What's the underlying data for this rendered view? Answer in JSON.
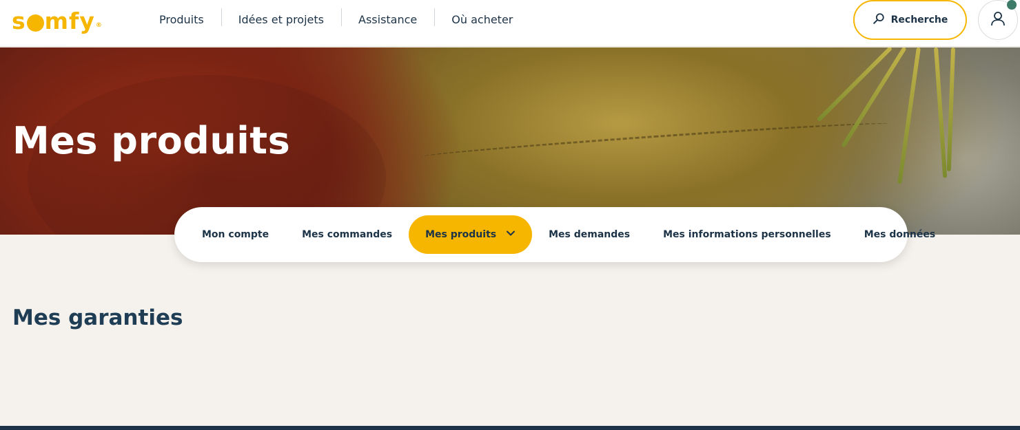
{
  "brand": {
    "logo_text": "somfy",
    "accent_color": "#f6b600",
    "dark_color": "#1c3347"
  },
  "header": {
    "nav": [
      "Produits",
      "Idées et projets",
      "Assistance",
      "Où acheter"
    ],
    "search_label": "Recherche"
  },
  "hero": {
    "title": "Mes produits"
  },
  "account_tabs": {
    "items": [
      "Mon compte",
      "Mes commandes",
      "Mes produits",
      "Mes demandes",
      "Mes informations personnelles",
      "Mes données"
    ],
    "active": "Mes produits"
  },
  "main": {
    "section_title": "Mes garanties"
  },
  "icons": [
    "search-icon",
    "user-icon",
    "chevron-down-icon"
  ]
}
